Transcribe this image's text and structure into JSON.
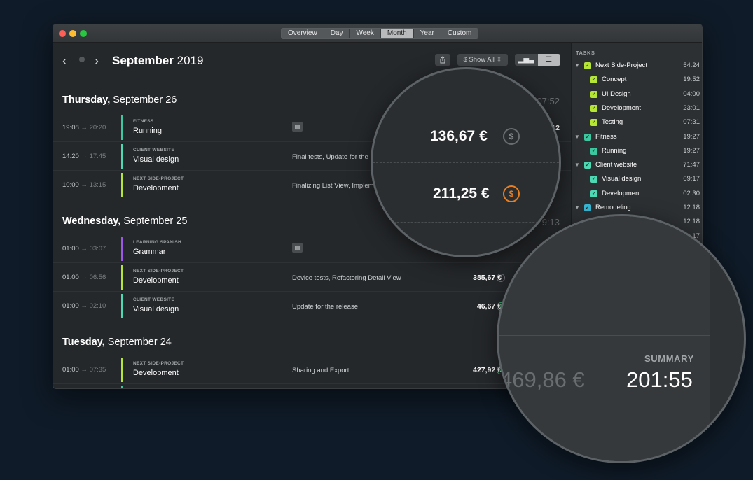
{
  "toolbar": {
    "segments": [
      "Overview",
      "Day",
      "Week",
      "Month",
      "Year",
      "Custom"
    ],
    "active_segment": "Month",
    "month_bold": "September",
    "year": "2019",
    "filter_label": "$ Show All",
    "share_icon": "share-icon",
    "view_chart_icon": "bar-chart-icon",
    "view_list_icon": "list-icon"
  },
  "days": [
    {
      "weekday": "Thursday,",
      "date": "September 26",
      "total": "07:52",
      "entries": [
        {
          "start": "19:08",
          "end": "20:20",
          "project": "FITNESS",
          "task": "Running",
          "note": "",
          "amount": "",
          "duration": ":12",
          "color": "#3cc8a0"
        },
        {
          "start": "14:20",
          "end": "17:45",
          "project": "CLIENT WEBSITE",
          "task": "Visual design",
          "note": "Final tests, Update for the",
          "amount": "",
          "duration": "",
          "color": "#4dd9b4"
        },
        {
          "start": "10:00",
          "end": "13:15",
          "project": "NEXT SIDE-PROJECT",
          "task": "Development",
          "note": "Finalizing List View, Implem",
          "amount": "",
          "duration": "",
          "color": "#b6e635"
        }
      ]
    },
    {
      "weekday": "Wednesday,",
      "date": "September 25",
      "total": "9:13",
      "entries": [
        {
          "start": "01:00",
          "end": "03:07",
          "project": "LEARNING SPANISH",
          "task": "Grammar",
          "note": "",
          "amount": "",
          "duration": "0",
          "color": "#9b59e6"
        },
        {
          "start": "01:00",
          "end": "06:56",
          "project": "NEXT SIDE-PROJECT",
          "task": "Development",
          "note": "Device tests, Refactoring Detail View",
          "amount": "385,67 €",
          "duration": "",
          "color": "#b6e635"
        },
        {
          "start": "01:00",
          "end": "02:10",
          "project": "CLIENT WEBSITE",
          "task": "Visual design",
          "note": "Update for the release",
          "amount": "46,67 €",
          "duration": "",
          "color": "#4dd9b4"
        }
      ]
    },
    {
      "weekday": "Tuesday,",
      "date": "September 24",
      "total": "427,92",
      "entries": [
        {
          "start": "01:00",
          "end": "07:35",
          "project": "NEXT SIDE-PROJECT",
          "task": "Development",
          "note": "Sharing and Export",
          "amount": "427,92 €",
          "duration": "",
          "color": "#b6e635"
        },
        {
          "start": "",
          "end": "",
          "project": "FITNESS",
          "task": "",
          "note": "",
          "amount": "",
          "duration": "",
          "color": "#3cc8a0"
        }
      ]
    }
  ],
  "sidebar": {
    "heading": "TASKS",
    "rows": [
      {
        "name": "Next Side-Project",
        "time": "54:24",
        "level": 0,
        "color": "#b6e635"
      },
      {
        "name": "Concept",
        "time": "19:52",
        "level": 1,
        "color": "#b6e635"
      },
      {
        "name": "UI Design",
        "time": "04:00",
        "level": 1,
        "color": "#b6e635"
      },
      {
        "name": "Development",
        "time": "23:01",
        "level": 1,
        "color": "#b6e635"
      },
      {
        "name": "Testing",
        "time": "07:31",
        "level": 1,
        "color": "#b6e635"
      },
      {
        "name": "Fitness",
        "time": "19:27",
        "level": 0,
        "color": "#3cc8a0"
      },
      {
        "name": "Running",
        "time": "19:27",
        "level": 1,
        "color": "#3cc8a0"
      },
      {
        "name": "Client website",
        "time": "71:47",
        "level": 0,
        "color": "#4dd9b4"
      },
      {
        "name": "Visual design",
        "time": "69:17",
        "level": 1,
        "color": "#4dd9b4"
      },
      {
        "name": "Development",
        "time": "02:30",
        "level": 1,
        "color": "#4dd9b4"
      },
      {
        "name": "Remodeling",
        "time": "12:18",
        "level": 0,
        "color": "#36b9d6"
      },
      {
        "name": "",
        "time": "12:18",
        "level": 1,
        "color": "#36b9d6"
      },
      {
        "name": "",
        "time": "17",
        "level": 1,
        "color": "#36b9d6"
      }
    ]
  },
  "magnifier_top": {
    "amount_unpaid": "136,67 €",
    "amount_paid": "211,25 €"
  },
  "magnifier_summary": {
    "label": "SUMMARY",
    "money": "469,86 €",
    "time": "201:55"
  }
}
